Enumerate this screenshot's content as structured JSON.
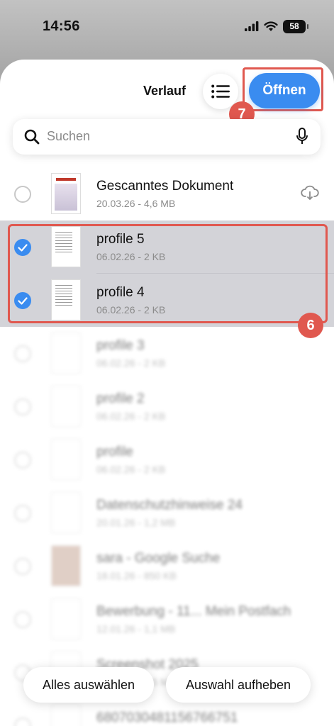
{
  "status_bar": {
    "time": "14:56",
    "battery": "58"
  },
  "header": {
    "title": "Verlauf",
    "open_label": "Öffnen"
  },
  "badges": {
    "step7": "7",
    "step6": "6"
  },
  "search": {
    "placeholder": "Suchen"
  },
  "files": [
    {
      "name": "Gescanntes Dokument",
      "meta": "20.03.26 - 4,6 MB",
      "selected": false
    },
    {
      "name": "profile 5",
      "meta": "06.02.26 - 2 KB",
      "selected": true
    },
    {
      "name": "profile 4",
      "meta": "06.02.26 - 2 KB",
      "selected": true
    },
    {
      "name": "profile 3",
      "meta": "06.02.26 - 2 KB",
      "selected": false
    },
    {
      "name": "profile 2",
      "meta": "06.02.26 - 2 KB",
      "selected": false
    },
    {
      "name": "profile",
      "meta": "06.02.26 - 2 KB",
      "selected": false
    },
    {
      "name": "Datenschutzhinweise 24",
      "meta": "20.01.26 - 1,2 MB",
      "selected": false
    },
    {
      "name": "sara - Google Suche",
      "meta": "18.01.26 - 850 KB",
      "selected": false
    },
    {
      "name": "Bewerbung - 11... Mein Postfach",
      "meta": "12.01.26 - 1,1 MB",
      "selected": false
    },
    {
      "name": "Screenshot 2025",
      "meta": "08.01.26 - 3,5 MB",
      "selected": false
    },
    {
      "name": "6807030481156766751",
      "meta": "",
      "selected": false
    }
  ],
  "footer": {
    "select_all": "Alles auswählen",
    "deselect": "Auswahl aufheben"
  },
  "colors": {
    "accent": "#3a8cf0",
    "annotation": "#e0584f"
  }
}
